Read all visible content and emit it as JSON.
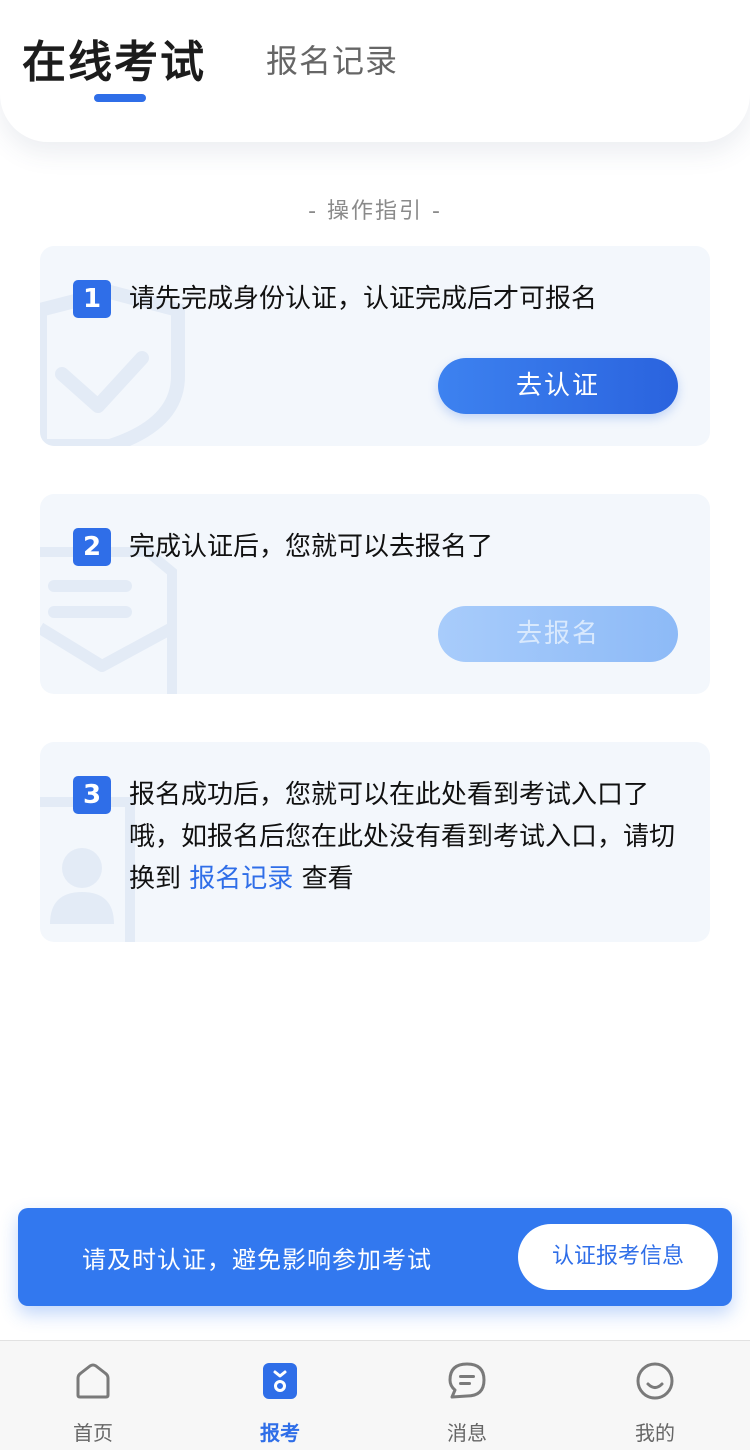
{
  "header": {
    "active_tab": "在线考试",
    "inactive_tab": "报名记录"
  },
  "guide": {
    "title": "- 操作指引 -"
  },
  "steps": [
    {
      "number": "1",
      "text": "请先完成身份认证，认证完成后才可报名",
      "button": "去认证",
      "button_state": "enabled",
      "watermark_icon": "shield-check-icon"
    },
    {
      "number": "2",
      "text": "完成认证后，您就可以去报名了",
      "button": "去报名",
      "button_state": "disabled",
      "watermark_icon": "document-icon"
    },
    {
      "number": "3",
      "text_before": "报名成功后，您就可以在此处看到考试入口了哦，如报名后您在此处没有看到考试入口，请切换到",
      "link": "报名记录",
      "text_after": "查看",
      "watermark_icon": "user-card-icon"
    }
  ],
  "notice": {
    "text": "请及时认证，避免影响参加考试",
    "button": "认证报考信息"
  },
  "tabbar": {
    "items": [
      {
        "label": "首页",
        "icon": "home-icon",
        "active": false
      },
      {
        "label": "报考",
        "icon": "exam-icon",
        "active": true
      },
      {
        "label": "消息",
        "icon": "message-icon",
        "active": false
      },
      {
        "label": "我的",
        "icon": "profile-icon",
        "active": false
      }
    ]
  },
  "colors": {
    "accent": "#2f6ee8",
    "card_bg": "#f3f7fc",
    "notice_bg": "#3278ef",
    "disabled_button": "#a8ccfb"
  }
}
